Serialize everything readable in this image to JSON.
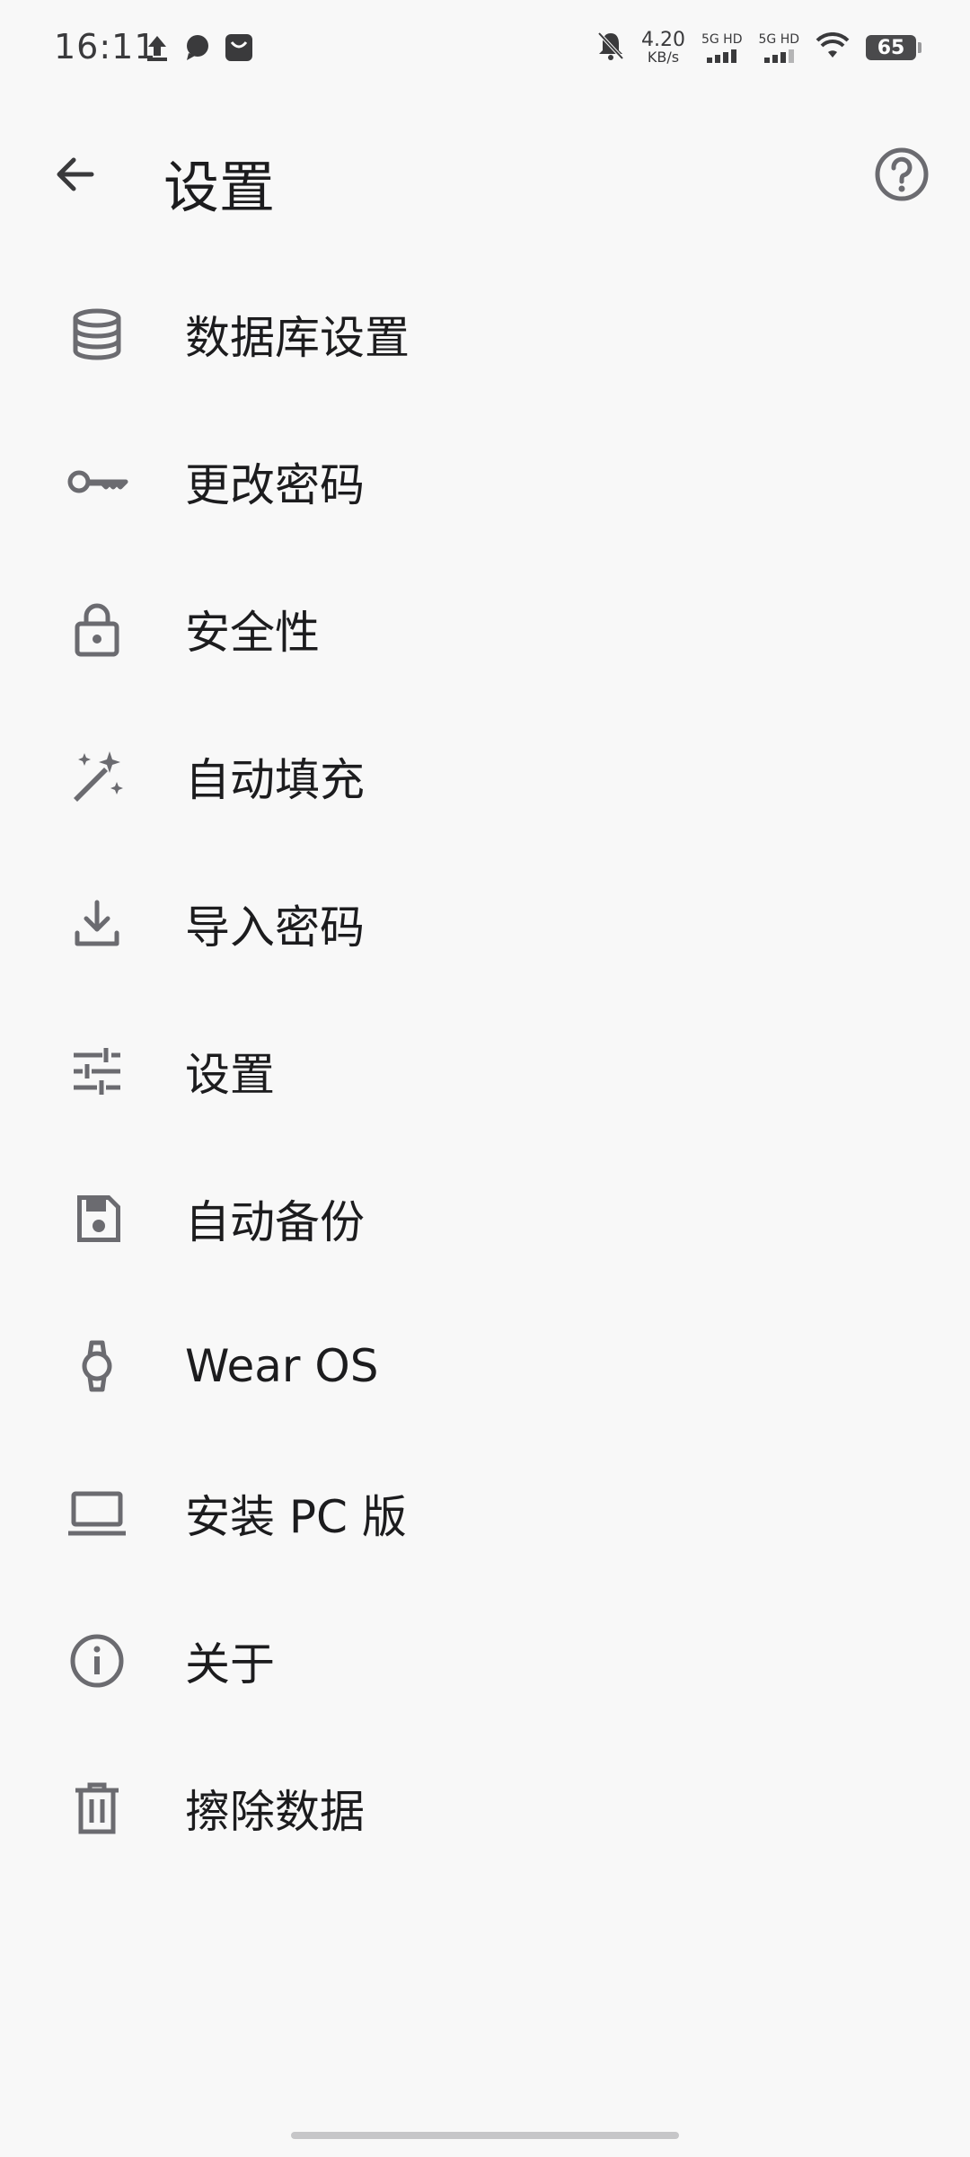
{
  "status_bar": {
    "time": "16:11",
    "net_speed_value": "4.20",
    "net_speed_unit": "KB/s",
    "sim1_label": "5G HD",
    "sim2_label": "5G HD",
    "battery": "65",
    "icons": [
      "upload-icon",
      "message-icon",
      "mail-app-icon",
      "bell-muted-icon",
      "wifi-icon",
      "battery-icon"
    ]
  },
  "appbar": {
    "title": "设置",
    "back_icon": "arrow-left-icon",
    "help_icon": "help-circle-icon"
  },
  "menu": {
    "items": [
      {
        "label": "数据库设置",
        "icon": "database-icon"
      },
      {
        "label": "更改密码",
        "icon": "key-icon"
      },
      {
        "label": "安全性",
        "icon": "lock-icon"
      },
      {
        "label": "自动填充",
        "icon": "magic-wand-icon"
      },
      {
        "label": "导入密码",
        "icon": "download-icon"
      },
      {
        "label": "设置",
        "icon": "tune-icon"
      },
      {
        "label": "自动备份",
        "icon": "save-icon"
      },
      {
        "label": "Wear OS",
        "icon": "watch-icon"
      },
      {
        "label": "安装 PC 版",
        "icon": "laptop-icon"
      },
      {
        "label": "关于",
        "icon": "info-icon"
      },
      {
        "label": "擦除数据",
        "icon": "trash-icon"
      }
    ]
  },
  "colors": {
    "background": "#f8f8f8",
    "icon": "#6b6b70",
    "text": "#1c1c1e"
  }
}
